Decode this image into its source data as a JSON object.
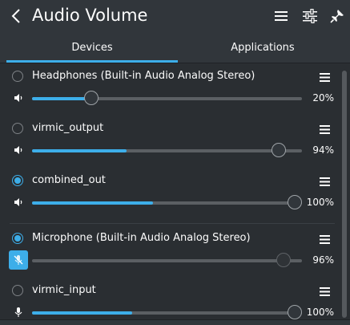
{
  "header": {
    "title": "Audio Volume",
    "icons": [
      "back-arrow-icon",
      "hamburger-menu-icon",
      "configure-icon",
      "pin-icon"
    ]
  },
  "tabs": [
    {
      "label": "Devices",
      "active": true
    },
    {
      "label": "Applications",
      "active": false
    }
  ],
  "devices": [
    {
      "name": "Headphones (Built-in Audio Analog Stereo)",
      "selected": false,
      "volume": 20,
      "percent": "20%",
      "icon": "speaker-icon",
      "muted": false
    },
    {
      "name": "virmic_output",
      "selected": false,
      "volume": 94,
      "percent": "94%",
      "icon": "speaker-icon",
      "muted": false
    },
    {
      "name": "combined_out",
      "selected": true,
      "volume": 100,
      "percent": "100%",
      "icon": "speaker-icon",
      "muted": false
    },
    {
      "name": "Microphone (Built-in Audio Analog Stereo)",
      "selected": true,
      "volume": 96,
      "percent": "96%",
      "icon": "microphone-muted-icon",
      "muted": true
    },
    {
      "name": "virmic_input",
      "selected": false,
      "volume": 100,
      "percent": "100%",
      "icon": "microphone-icon",
      "muted": false
    }
  ],
  "colors": {
    "accent": "#3daee9",
    "background": "#2a2e32",
    "header": "#31363b",
    "text": "#fcfcfc",
    "track": "#5b5f63"
  }
}
